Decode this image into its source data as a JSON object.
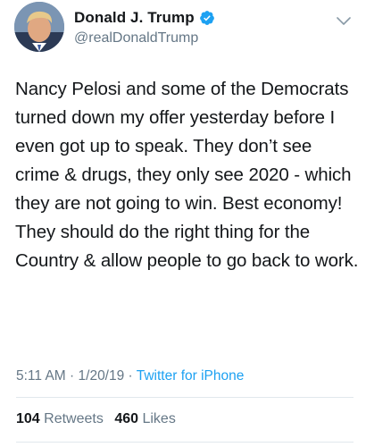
{
  "user": {
    "display_name": "Donald J. Trump",
    "handle": "@realDonaldTrump",
    "verified": true,
    "avatar_icon": "profile-photo",
    "verified_icon": "verified-badge-icon"
  },
  "tweet": {
    "text": "Nancy Pelosi and some of the Democrats turned down my offer yesterday before I even got up to speak. They don’t see crime & drugs, they only see 2020 - which they are not going to win. Best economy! They should do the right thing for the Country & allow people to go back to work.",
    "time": "5:11 AM",
    "date": "1/20/19",
    "separator": "·",
    "source": "Twitter for iPhone"
  },
  "stats": {
    "retweets_count": "104",
    "retweets_label": "Retweets",
    "likes_count": "460",
    "likes_label": "Likes"
  },
  "colors": {
    "accent": "#1da1f2",
    "muted": "#657786",
    "text": "#14171a",
    "divider": "#e1e8ed"
  }
}
